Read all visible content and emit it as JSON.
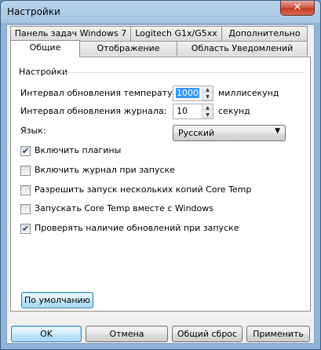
{
  "window": {
    "title": "Настройки",
    "close_label": "✕"
  },
  "tabs_row1": [
    {
      "label": "Панель задач Windows 7"
    },
    {
      "label": "Logitech G1x/G5xx"
    },
    {
      "label": "Дополнительно"
    }
  ],
  "tabs_row2": [
    {
      "label": "Общие",
      "active": true
    },
    {
      "label": "Отображение"
    },
    {
      "label": "Область Уведомлений"
    }
  ],
  "group": {
    "title": "Настройки"
  },
  "settings": {
    "temp_interval": {
      "label": "Интервал обновления температур:",
      "value": "1000",
      "unit": "миллисекунд"
    },
    "log_interval": {
      "label": "Интервал обновления журнала:",
      "value": "10",
      "unit": "секунд"
    },
    "language": {
      "label": "Язык:",
      "value": "Русский"
    }
  },
  "checkboxes": [
    {
      "label": "Включить плагины",
      "checked": true
    },
    {
      "label": "Включить журнал при запуске",
      "checked": false
    },
    {
      "label": "Разрешить запуск нескольких копий Core Temp",
      "checked": false
    },
    {
      "label": "Запускать Core Temp вместе с Windows",
      "checked": false
    },
    {
      "label": "Проверять наличие обновлений при запуске",
      "checked": true
    }
  ],
  "buttons": {
    "defaults": "По умолчанию",
    "ok": "OK",
    "cancel": "Отмена",
    "reset": "Общий сброс",
    "apply": "Применить"
  }
}
